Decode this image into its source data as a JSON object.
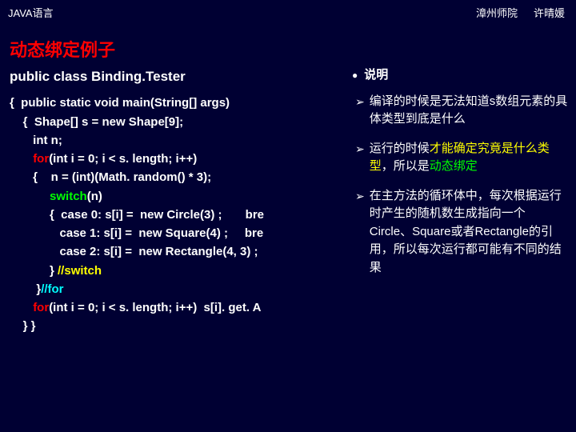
{
  "header": {
    "left": "JAVA语言",
    "right1": "漳州师院",
    "right2": "许晴媛"
  },
  "title": "动态绑定例子",
  "code": {
    "classDecl": "public class Binding.Tester",
    "l1": "{  public static void main(String[] args)",
    "l2": "    {  Shape[] s = new Shape[9];",
    "l3": "       int n;",
    "l4a": "       for(int i = 0; i < s. length; i++)",
    "l5a": "       {    n = (int)(Math. random() * 3);",
    "l6a": "            switch(n)",
    "l7": "            {  case 0: s[i] =  new Circle(3) ;       bre",
    "l8": "               case 1: s[i] =  new Square(4) ;     bre",
    "l9": "               case 2: s[i] =  new Rectangle(4, 3) ;",
    "l10": "            } ",
    "l10c": "//switch",
    "l11": "        }",
    "l11c": "//for",
    "l12a": "       for(int i = 0; i < s. length; i++)  s[i]. get. A",
    "l13": "    } }"
  },
  "kw": {
    "for": "for",
    "switch": "switch"
  },
  "explain": {
    "head": "说明",
    "p1a": "编译的时候是无法知道s数组元素的具体类型到底是什么",
    "p2a": "运行的时候",
    "p2b": "才能确定究竟是什么类型",
    "p2c": "，所以是",
    "p2d": "动态绑定",
    "p3": "在主方法的循环体中，每次根据运行时产生的随机数生成指向一个Circle、Square或者Rectangle的引用，所以每次运行都可能有不同的结果"
  }
}
